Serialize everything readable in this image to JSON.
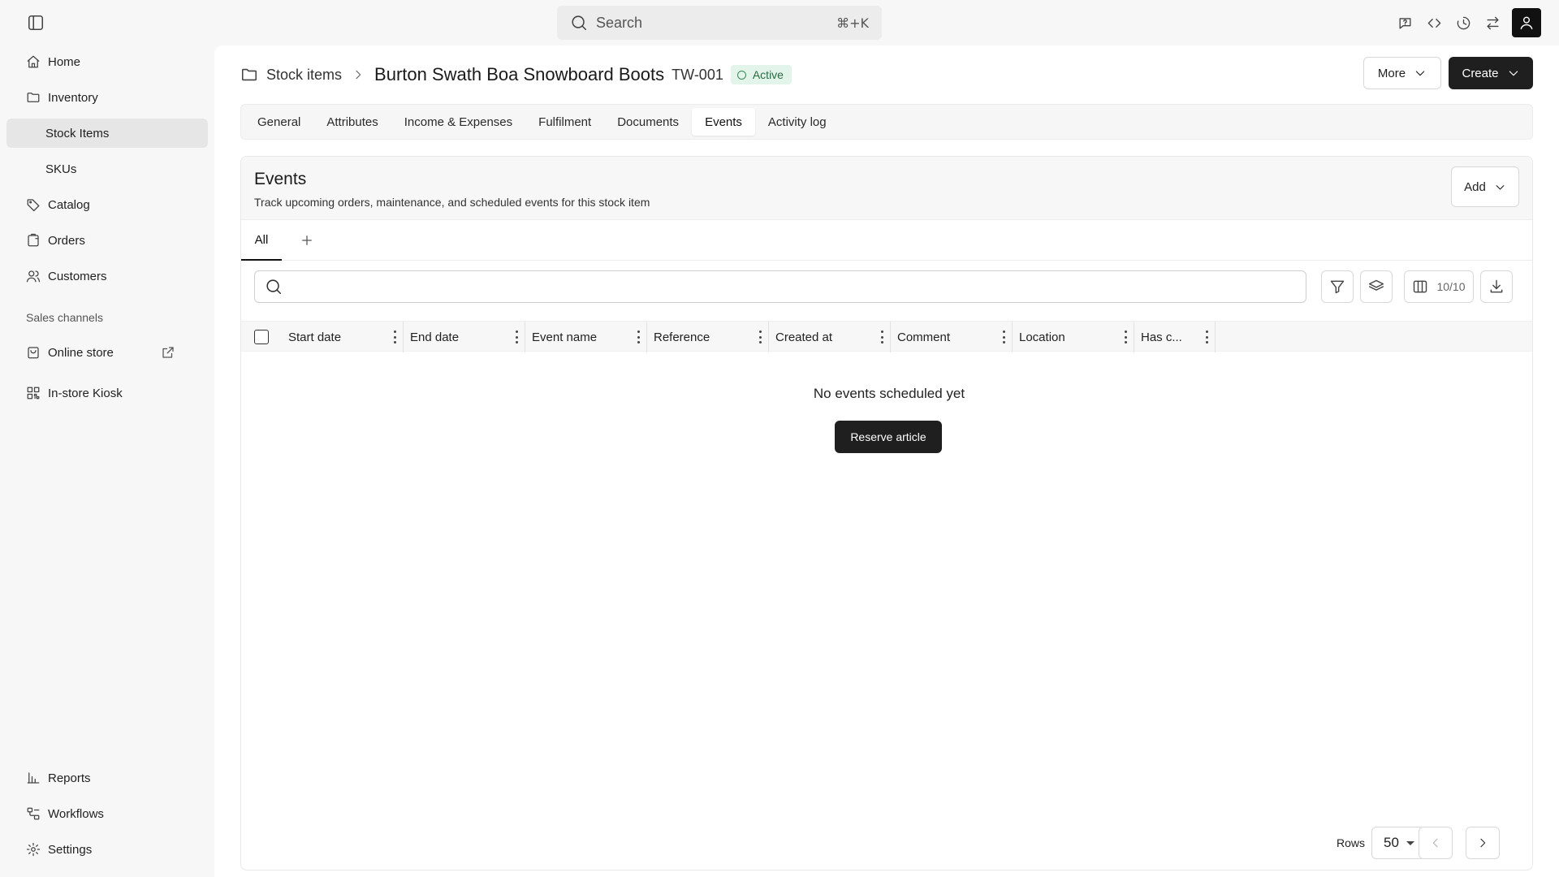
{
  "topbar": {
    "search_placeholder": "Search",
    "search_shortcut": "⌘+K",
    "actions": [
      "help-icon",
      "code-icon",
      "history-icon",
      "switch-icon"
    ]
  },
  "sidebar": {
    "items": [
      {
        "label": "Home",
        "icon": "home-icon"
      },
      {
        "label": "Inventory",
        "icon": "folder-icon"
      },
      {
        "label": "Stock Items",
        "sub": true,
        "active": true
      },
      {
        "label": "SKUs",
        "sub": true
      },
      {
        "label": "Catalog",
        "icon": "tag-icon"
      },
      {
        "label": "Orders",
        "icon": "orders-icon"
      },
      {
        "label": "Customers",
        "icon": "users-icon"
      }
    ],
    "section_label": "Sales channels",
    "channels": [
      {
        "label": "Online store",
        "icon": "store-icon",
        "external": true
      },
      {
        "label": "In-store Kiosk",
        "icon": "kiosk-icon"
      }
    ],
    "bottom": [
      {
        "label": "Reports",
        "icon": "chart-icon"
      },
      {
        "label": "Workflows",
        "icon": "workflow-icon"
      },
      {
        "label": "Settings",
        "icon": "gear-icon"
      }
    ]
  },
  "header": {
    "breadcrumb_parent": "Stock items",
    "title": "Burton Swath Boa Snowboard Boots",
    "code": "TW-001",
    "status": "Active",
    "more_label": "More",
    "create_label": "Create"
  },
  "tabs": [
    {
      "label": "General"
    },
    {
      "label": "Attributes"
    },
    {
      "label": "Income & Expenses"
    },
    {
      "label": "Fulfilment"
    },
    {
      "label": "Documents"
    },
    {
      "label": "Events",
      "active": true
    },
    {
      "label": "Activity log"
    }
  ],
  "events": {
    "title": "Events",
    "subtitle": "Track upcoming orders, maintenance, and scheduled events for this stock item",
    "add_label": "Add",
    "view_tab": "All",
    "search_placeholder": "",
    "columns_count": "10/10",
    "columns": [
      "Start date",
      "End date",
      "Event name",
      "Reference",
      "Created at",
      "Comment",
      "Location",
      "Has c..."
    ],
    "empty_message": "No events scheduled yet",
    "reserve_label": "Reserve article",
    "rows_label": "Rows",
    "rows_value": "50"
  },
  "colors": {
    "primary": "#1f1f1f",
    "active_badge_bg": "#e3f4ea",
    "active_badge_text": "#2a6a3f",
    "sidebar_active": "#e6e6e6"
  }
}
